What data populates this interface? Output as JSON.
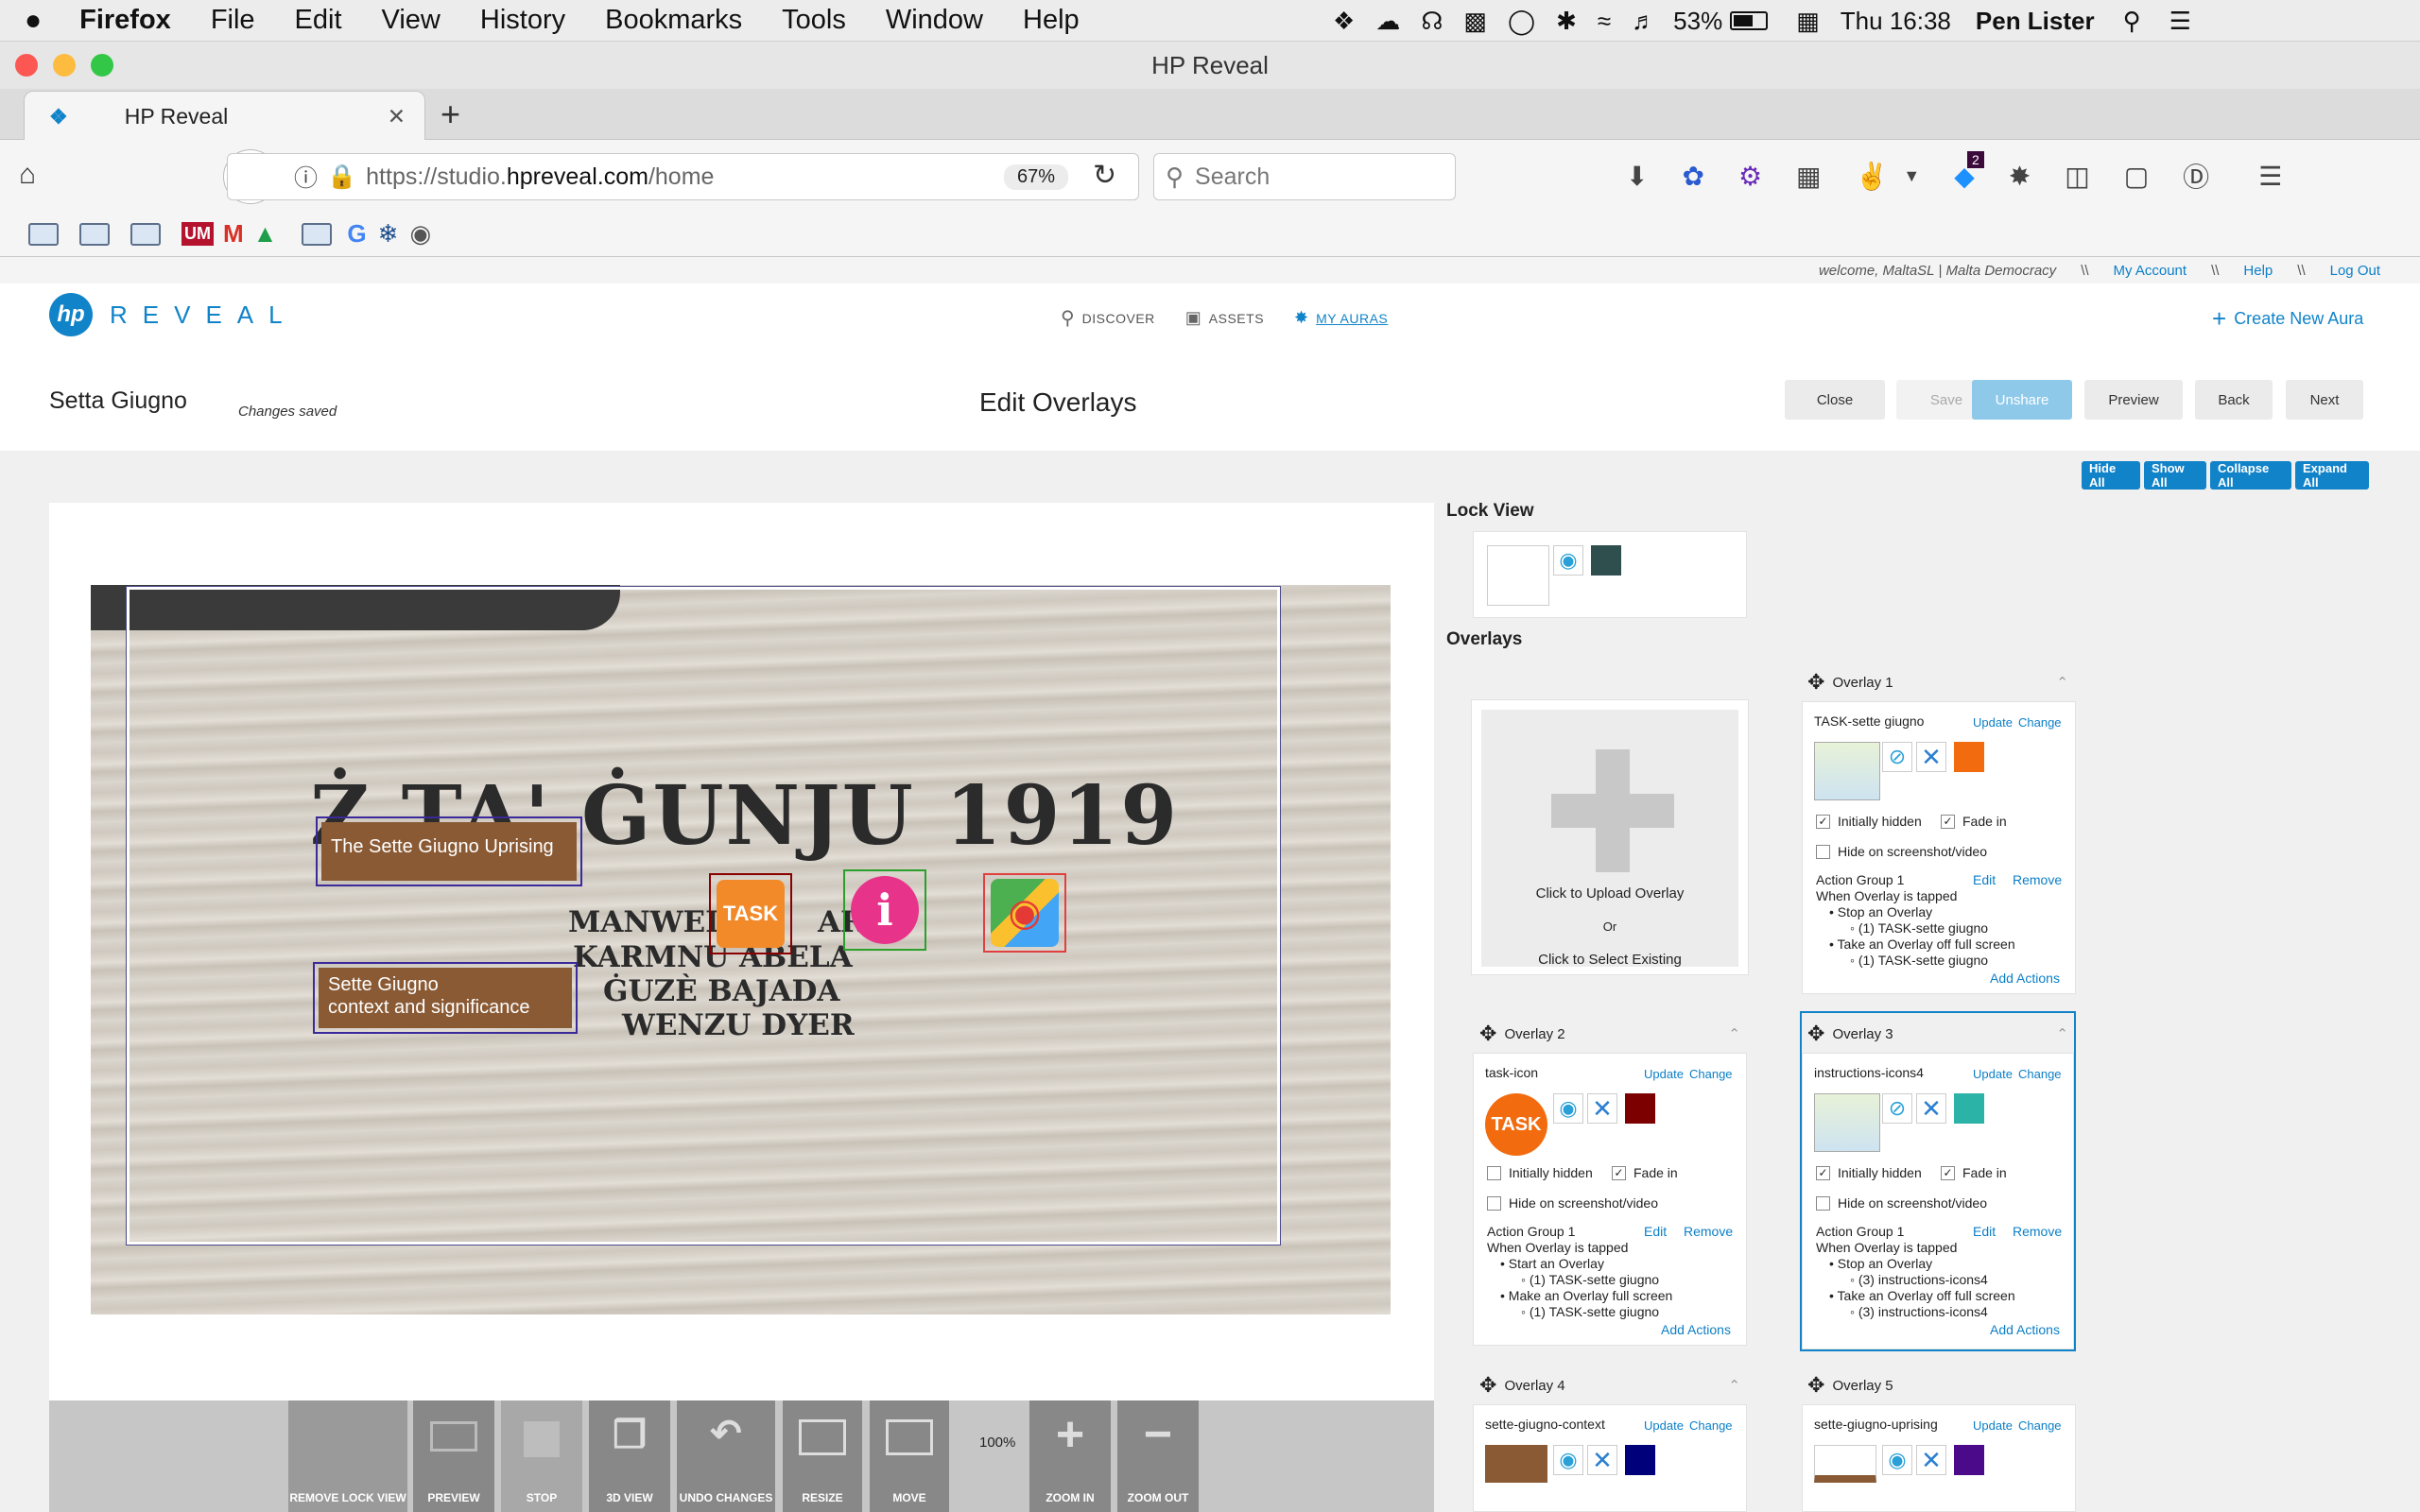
{
  "macmenu": {
    "app": "Firefox",
    "items": [
      "File",
      "Edit",
      "View",
      "History",
      "Bookmarks",
      "Tools",
      "Window",
      "Help"
    ],
    "battery": "53%",
    "clock": "Thu 16:38",
    "user": "Pen Lister"
  },
  "window": {
    "title": "HP Reveal"
  },
  "tab": {
    "label": "HP Reveal"
  },
  "nav": {
    "url_prefix": "https://studio.",
    "url_host": "hpreveal.com",
    "url_path": "/home",
    "zoom": "67%",
    "search_placeholder": "Search",
    "notif_count": "2"
  },
  "site": {
    "welcome": "welcome, MaltaSL | Malta Democracy",
    "sep": "\\\\",
    "my_account": "My Account",
    "help": "Help",
    "logout": "Log Out",
    "logo_hp": "hp",
    "logo_text": "REVEAL",
    "nav": [
      "DISCOVER",
      "ASSETS",
      "MY AURAS"
    ],
    "create": "Create New Aura"
  },
  "editor": {
    "aura_name": "Setta Giugno",
    "status": "Changes saved",
    "heading": "Edit Overlays",
    "buttons": [
      "Close",
      "Save",
      "Unshare",
      "Preview",
      "Back",
      "Next"
    ],
    "panel_buttons": [
      "Hide All",
      "Show All",
      "Collapse All",
      "Expand All"
    ]
  },
  "photo": {
    "line1": "Ż  TA'  ĠUNJU 1919",
    "names": [
      "MANWEL         ARI",
      "KARMNU ABELA",
      "ĠUZÈ BAJADA",
      "WENZU DYER"
    ],
    "overlay_uprising": "The Sette Giugno Uprising",
    "overlay_context_1": "Sette Giugno",
    "overlay_context_2": "context and significance",
    "task_icon": "TASK",
    "info_icon": "i"
  },
  "toolbar": {
    "items": [
      "REMOVE LOCK VIEW",
      "PREVIEW",
      "STOP",
      "3D VIEW",
      "UNDO CHANGES",
      "RESIZE",
      "MOVE"
    ],
    "zoom": "100%",
    "zoom_in": "ZOOM IN",
    "zoom_out": "ZOOM OUT"
  },
  "lockview": {
    "title": "Lock View",
    "swatch": "#2f4f4f"
  },
  "overlays_title": "Overlays",
  "upload": {
    "line1": "Click to Upload Overlay",
    "or": "Or",
    "line2": "Click to Select Existing"
  },
  "common": {
    "update": "Update",
    "change": "Change",
    "initially_hidden": "Initially hidden",
    "fade_in": "Fade in",
    "hide_on_screenshot": "Hide on screenshot/video",
    "edit": "Edit",
    "remove": "Remove",
    "add_actions": "Add Actions",
    "action_group": "Action Group 1",
    "when": "When Overlay is tapped"
  },
  "overlays": [
    {
      "title": "Overlay 1",
      "name": "TASK-sette giugno",
      "color": "#f26b0f",
      "hidden": true,
      "fade": true,
      "a1": "Stop an Overlay",
      "a1s": "(1) TASK-sette giugno",
      "a2": "Take an Overlay off full screen",
      "a2s": "(1) TASK-sette giugno"
    },
    {
      "title": "Overlay 2",
      "name": "task-icon",
      "color": "#7d0000",
      "hidden": false,
      "fade": true,
      "a1": "Start an Overlay",
      "a1s": "(1) TASK-sette giugno",
      "a2": "Make an Overlay full screen",
      "a2s": "(1) TASK-sette giugno"
    },
    {
      "title": "Overlay 3",
      "name": "instructions-icons4",
      "color": "#2bb3a8",
      "hidden": true,
      "fade": true,
      "a1": "Stop an Overlay",
      "a1s": "(3) instructions-icons4",
      "a2": "Take an Overlay off full screen",
      "a2s": "(3) instructions-icons4"
    },
    {
      "title": "Overlay 4",
      "name": "sette-giugno-context",
      "color": "#00007a"
    },
    {
      "title": "Overlay 5",
      "name": "sette-giugno-uprising",
      "color": "#4b0a8a"
    }
  ]
}
